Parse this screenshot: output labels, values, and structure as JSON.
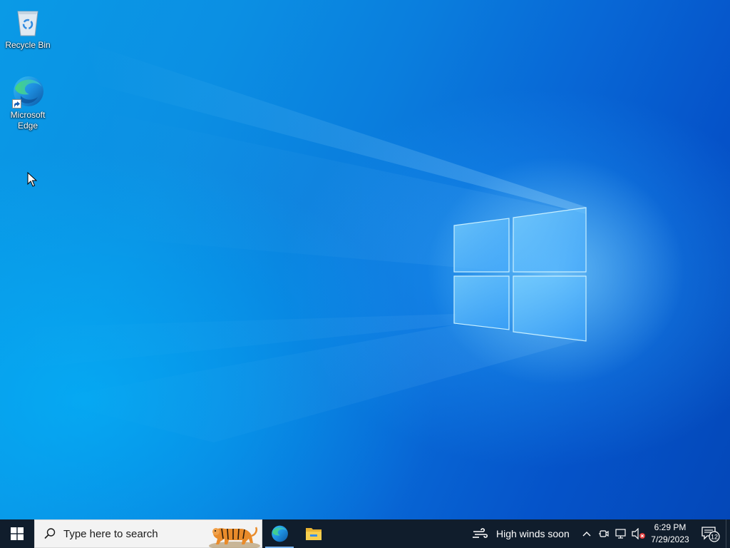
{
  "desktop": {
    "icons": [
      {
        "label": "Recycle Bin",
        "icon": "recycle-bin-icon"
      },
      {
        "label": "Microsoft Edge",
        "icon": "edge-icon"
      }
    ]
  },
  "taskbar": {
    "start_icon": "windows-logo-icon",
    "search": {
      "placeholder": "Type here to search",
      "icon": "search-icon"
    },
    "pinned_apps": [
      {
        "name": "Microsoft Edge",
        "icon": "edge-icon",
        "active": true
      },
      {
        "name": "File Explorer",
        "icon": "folder-icon",
        "active": false
      }
    ],
    "weather": {
      "text": "High winds soon",
      "icon": "wind-icon"
    },
    "tray": {
      "icons": [
        "chevron-up-icon",
        "meet-now-icon",
        "network-disconnected-icon",
        "volume-muted-icon"
      ]
    },
    "clock": {
      "time": "6:29 PM",
      "date": "7/29/2023"
    },
    "notifications": {
      "count": "12",
      "icon": "notification-center-icon"
    }
  },
  "colors": {
    "taskbar_bg": "#101d2c",
    "wallpaper_blue": "#0a7ddd",
    "accent": "#7cb6f2"
  }
}
